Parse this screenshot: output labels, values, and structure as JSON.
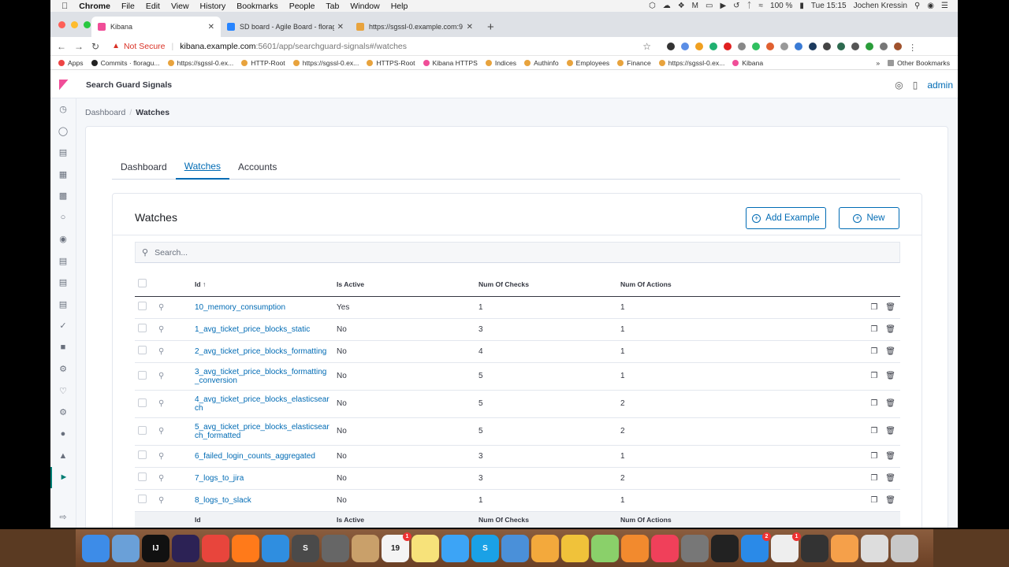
{
  "menubar": {
    "app": "Chrome",
    "items": [
      "File",
      "Edit",
      "View",
      "History",
      "Bookmarks",
      "People",
      "Tab",
      "Window",
      "Help"
    ],
    "battery": "100 %",
    "clock": "Tue 15:15",
    "user": "Jochen Kressin"
  },
  "browser": {
    "tabs": [
      {
        "label": "Kibana",
        "color": "#f04e98"
      },
      {
        "label": "SD board - Agile Board - florag",
        "color": "#2684ff"
      },
      {
        "label": "https://sgssl-0.example.com:9",
        "color": "#e8a33d"
      }
    ],
    "new_tab": "+",
    "not_secure": "Not Secure",
    "url_host": "kibana.example.com",
    "url_path": ":5601/app/searchguard-signals#/watches",
    "bookmarks": [
      {
        "label": "Apps",
        "color": "#e44"
      },
      {
        "label": "Commits · floragu...",
        "color": "#222"
      },
      {
        "label": "https://sgssl-0.ex...",
        "color": "#e8a33d"
      },
      {
        "label": "HTTP-Root",
        "color": "#e8a33d"
      },
      {
        "label": "https://sgssl-0.ex...",
        "color": "#e8a33d"
      },
      {
        "label": "HTTPS-Root",
        "color": "#e8a33d"
      },
      {
        "label": "Kibana HTTPS",
        "color": "#f04e98"
      },
      {
        "label": "Indices",
        "color": "#e8a33d"
      },
      {
        "label": "Authinfo",
        "color": "#e8a33d"
      },
      {
        "label": "Employees",
        "color": "#e8a33d"
      },
      {
        "label": "Finance",
        "color": "#e8a33d"
      },
      {
        "label": "https://sgssl-0.ex...",
        "color": "#e8a33d"
      },
      {
        "label": "Kibana",
        "color": "#f04e98"
      }
    ],
    "overflow": "»",
    "other_bookmarks": "Other Bookmarks"
  },
  "kibana": {
    "app_title": "Search Guard Signals",
    "user": "admin",
    "breadcrumbs": {
      "root": "Dashboard",
      "separator": "/",
      "current": "Watches"
    },
    "tabs": [
      "Dashboard",
      "Watches",
      "Accounts"
    ],
    "selected_tab": "Watches",
    "section_title": "Watches",
    "add_example_label": "Add Example",
    "new_label": "New",
    "search_placeholder": "Search...",
    "columns": {
      "id": "Id",
      "active": "Is Active",
      "checks": "Num Of Checks",
      "actions": "Num Of Actions"
    },
    "sort_indicator": "↑",
    "watches": [
      {
        "id": "10_memory_consumption",
        "active": "Yes",
        "checks": "1",
        "actions": "1"
      },
      {
        "id": "1_avg_ticket_price_blocks_static",
        "active": "No",
        "checks": "3",
        "actions": "1"
      },
      {
        "id": "2_avg_ticket_price_blocks_formatting",
        "active": "No",
        "checks": "4",
        "actions": "1"
      },
      {
        "id": "3_avg_ticket_price_blocks_formatting_conversion",
        "active": "No",
        "checks": "5",
        "actions": "1"
      },
      {
        "id": "4_avg_ticket_price_blocks_elasticsearch",
        "active": "No",
        "checks": "5",
        "actions": "2"
      },
      {
        "id": "5_avg_ticket_price_blocks_elasticsearch_formatted",
        "active": "No",
        "checks": "5",
        "actions": "2"
      },
      {
        "id": "6_failed_login_counts_aggregated",
        "active": "No",
        "checks": "3",
        "actions": "1"
      },
      {
        "id": "7_logs_to_jira",
        "active": "No",
        "checks": "3",
        "actions": "2"
      },
      {
        "id": "8_logs_to_slack",
        "active": "No",
        "checks": "1",
        "actions": "1"
      }
    ]
  },
  "dock": [
    {
      "name": "finder",
      "color": "#3d8ce8"
    },
    {
      "name": "preview",
      "color": "#6aa0d8"
    },
    {
      "name": "intellij",
      "color": "#111",
      "glyph": "IJ"
    },
    {
      "name": "eclipse",
      "color": "#2c2255"
    },
    {
      "name": "chrome",
      "color": "#e8453c"
    },
    {
      "name": "firefox",
      "color": "#ff7a1a"
    },
    {
      "name": "safari",
      "color": "#2f8ee0"
    },
    {
      "name": "sublime",
      "color": "#4a4a4a",
      "glyph": "S"
    },
    {
      "name": "launchpad",
      "color": "#666"
    },
    {
      "name": "notefile",
      "color": "#c9a06a"
    },
    {
      "name": "calendar",
      "color": "#f4f4f4",
      "glyph": "19",
      "badge": "1"
    },
    {
      "name": "notes",
      "color": "#f7e27a"
    },
    {
      "name": "messages",
      "color": "#3ca4f6"
    },
    {
      "name": "skype",
      "color": "#1aa1e6",
      "glyph": "S"
    },
    {
      "name": "keynote",
      "color": "#4a90d9"
    },
    {
      "name": "pages",
      "color": "#f3a93c"
    },
    {
      "name": "photos",
      "color": "#f0c23a"
    },
    {
      "name": "maps",
      "color": "#8ad06a"
    },
    {
      "name": "books",
      "color": "#f28a2e"
    },
    {
      "name": "music",
      "color": "#f0405a"
    },
    {
      "name": "system-preferences",
      "color": "#777"
    },
    {
      "name": "terminal",
      "color": "#222"
    },
    {
      "name": "app-store",
      "color": "#2a8ae8",
      "badge": "2"
    },
    {
      "name": "slack",
      "color": "#eee",
      "badge": "1"
    },
    {
      "name": "activity-monitor",
      "color": "#333"
    },
    {
      "name": "pinwheel",
      "color": "#f5a04a"
    },
    {
      "name": "java",
      "color": "#ddd"
    },
    {
      "name": "trash",
      "color": "#c8c8c8"
    }
  ]
}
